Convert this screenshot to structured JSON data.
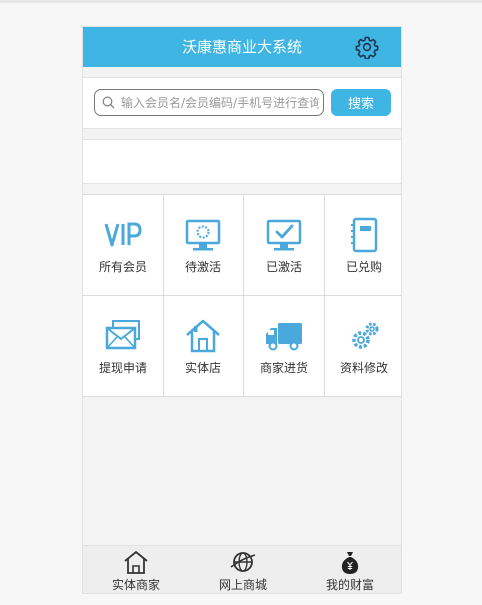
{
  "header": {
    "title": "沃康惠商业大系统",
    "settings_icon": "gear-icon"
  },
  "search": {
    "placeholder": "输入会员名/会员编码/手机号进行查询",
    "button_label": "搜索"
  },
  "colors": {
    "accent": "#3fb5e3",
    "icon": "#4aa8dc"
  },
  "menu": [
    {
      "label": "所有会员",
      "icon": "vip-icon"
    },
    {
      "label": "待激活",
      "icon": "monitor-loading-icon"
    },
    {
      "label": "已激活",
      "icon": "monitor-check-icon"
    },
    {
      "label": "已兑购",
      "icon": "notebook-icon"
    },
    {
      "label": "提现申请",
      "icon": "envelope-icon"
    },
    {
      "label": "实体店",
      "icon": "store-house-icon"
    },
    {
      "label": "商家进货",
      "icon": "truck-icon"
    },
    {
      "label": "资料修改",
      "icon": "gears-icon"
    }
  ],
  "tabs": [
    {
      "label": "实体商家",
      "icon": "house-icon"
    },
    {
      "label": "网上商城",
      "icon": "globe-icon"
    },
    {
      "label": "我的财富",
      "icon": "money-bag-icon"
    }
  ]
}
